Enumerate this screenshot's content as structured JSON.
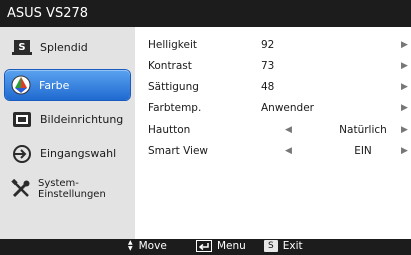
{
  "title": "ASUS VS278",
  "sidebar": {
    "items": [
      {
        "label": "Splendid",
        "icon": "splendid-s-icon",
        "active": false
      },
      {
        "label": "Farbe",
        "icon": "color-palette-icon",
        "active": true
      },
      {
        "label": "Bildeinrichtung",
        "icon": "image-setup-icon",
        "active": false
      },
      {
        "label": "Eingangswahl",
        "icon": "input-select-icon",
        "active": false
      },
      {
        "label": "System-Einstellungen",
        "icon": "wrench-screwdriver-icon",
        "active": false
      }
    ]
  },
  "settings": [
    {
      "label": "Helligkeit",
      "value": "92"
    },
    {
      "label": "Kontrast",
      "value": "73"
    },
    {
      "label": "Sättigung",
      "value": "48"
    },
    {
      "label": "Farbtemp.",
      "value": "Anwender"
    },
    {
      "label": "Hautton",
      "option": "Natürlich"
    },
    {
      "label": "Smart View",
      "option": "EIN"
    }
  ],
  "arrows": {
    "left": "◀",
    "right": "▶"
  },
  "footer": {
    "move": "Move",
    "menu": "Menu",
    "exit_key": "S",
    "exit": "Exit"
  },
  "colors": {
    "bar": "#1c1c1c",
    "sidebar": "#e3e3e3",
    "active_top": "#5aa3f0",
    "active_bottom": "#1f69d0"
  }
}
